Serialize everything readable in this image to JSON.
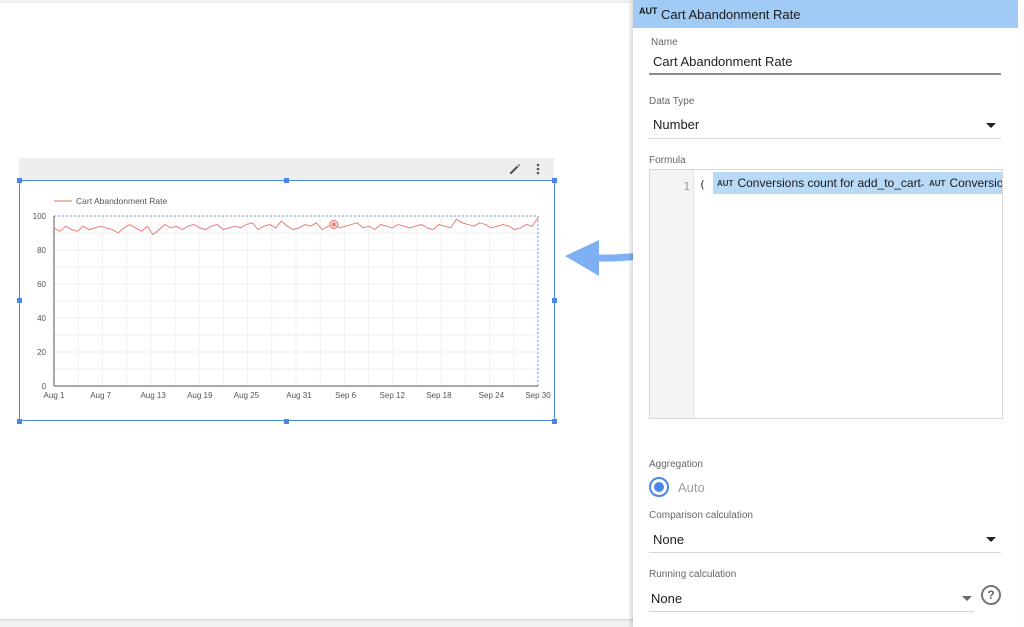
{
  "colors": {
    "accent": "#4a86e8",
    "panel_header": "#9fcbf5",
    "chip": "#b8daf7",
    "series_line": "#e8716b",
    "arrow": "#7fb0f3"
  },
  "chart_widget": {
    "toolbar_icons": [
      "pencil-icon",
      "more-vertical-icon"
    ]
  },
  "chart_data": {
    "type": "line",
    "title": "",
    "legend": "top-left",
    "series": [
      {
        "name": "Cart Abandonment Rate",
        "values": [
          93,
          91,
          94,
          92,
          91,
          94,
          92,
          93,
          94,
          93,
          92,
          90,
          93,
          95,
          93,
          91,
          94,
          89,
          92,
          95,
          93,
          94,
          92,
          94,
          95,
          93,
          92,
          94,
          95,
          92,
          93,
          94,
          93,
          95,
          96,
          92,
          94,
          95,
          93,
          97,
          94,
          92,
          93,
          95,
          94,
          96,
          92,
          94,
          95,
          93,
          94,
          95,
          96,
          93,
          94,
          92,
          95,
          94,
          93,
          95,
          94,
          93,
          94,
          95,
          93,
          92,
          95,
          94,
          93,
          98,
          96,
          95,
          94,
          96,
          95,
          93,
          94,
          95,
          94,
          92,
          93,
          95,
          94,
          99
        ]
      }
    ],
    "x_tick_labels": [
      "Aug 1",
      "Aug 7",
      "Aug 13",
      "Aug 19",
      "Aug 25",
      "Aug 31",
      "Sep 6",
      "Sep 12",
      "Sep 18",
      "Sep 24",
      "Sep 30"
    ],
    "yticks": [
      0,
      20,
      40,
      60,
      80,
      100
    ],
    "ylim": [
      0,
      100
    ],
    "grid": true,
    "highlight_index": 48
  },
  "panel": {
    "header_badge": "AUT",
    "header_title": "Cart Abandonment Rate",
    "name_label": "Name",
    "name_value": "Cart Abandonment Rate",
    "data_type_label": "Data Type",
    "data_type_value": "Number",
    "formula_label": "Formula",
    "formula_line_number": "1",
    "formula_open": "( (",
    "formula_chip1_badge": "AUT",
    "formula_chip1_text": "Conversions count for add_to_cart",
    "formula_operator": "-",
    "formula_chip2_badge": "AUT",
    "formula_chip2_text": "Conversion",
    "aggregation_label": "Aggregation",
    "aggregation_value": "Auto",
    "comparison_label": "Comparison calculation",
    "comparison_value": "None",
    "running_label": "Running calculation",
    "running_value": "None",
    "help_glyph": "?"
  }
}
